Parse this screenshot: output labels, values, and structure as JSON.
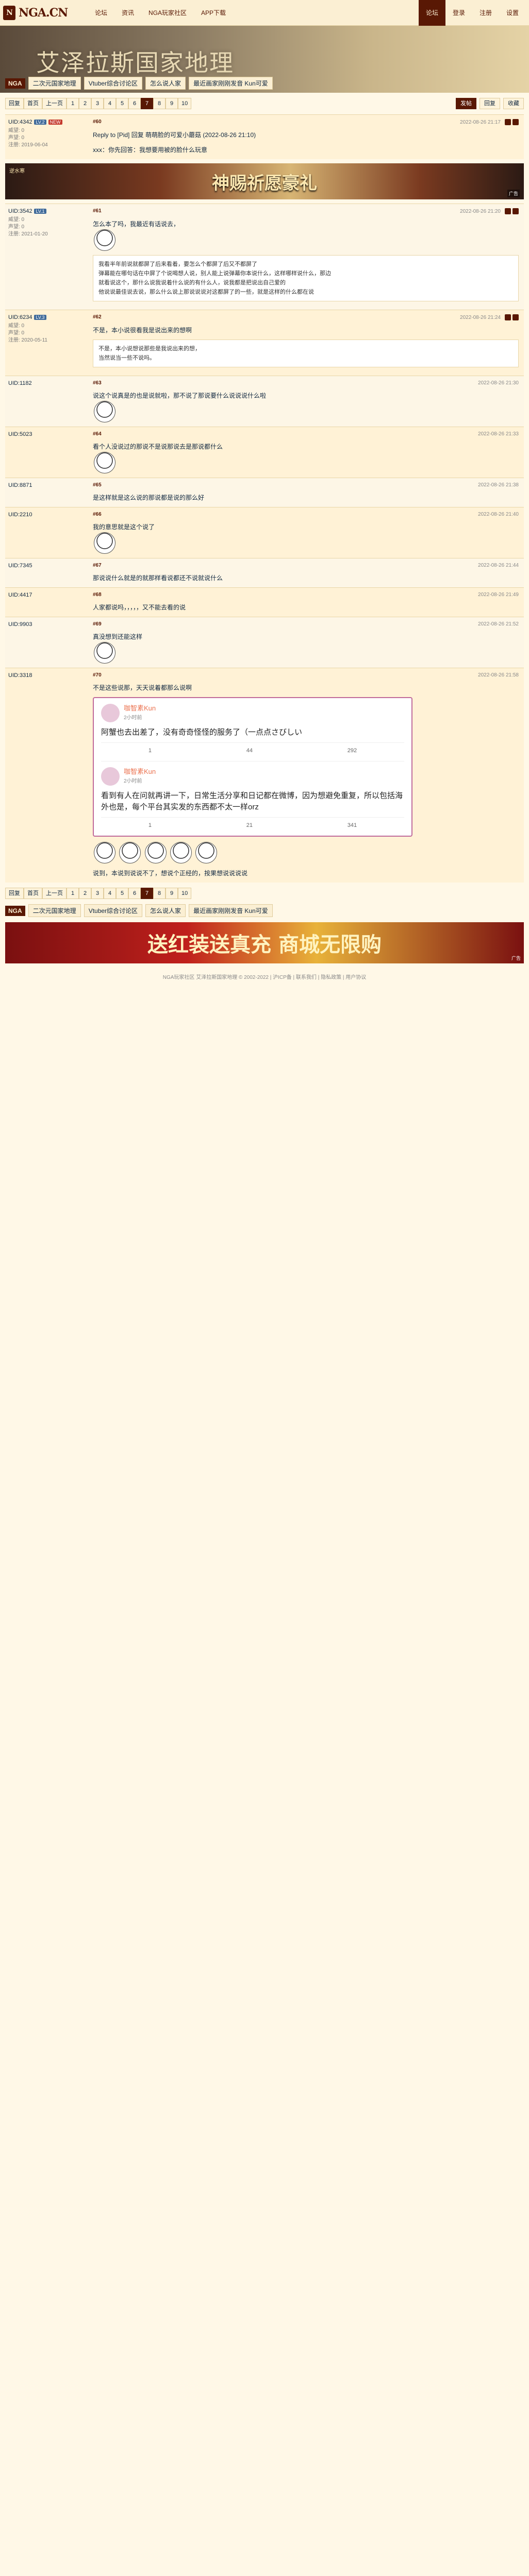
{
  "site": {
    "logo": "NGA.CN",
    "nav": [
      "论坛",
      "资讯",
      "NGA玩家社区",
      "APP下载"
    ],
    "nav_right": [
      "论坛",
      "登录",
      "注册",
      "设置"
    ]
  },
  "banner": {
    "title": "艾泽拉斯国家地理",
    "home": "NGA",
    "crumbs": [
      "二次元国家地理",
      "Vtuber综合讨论区",
      "怎么说人家",
      "最近画家刚刚发音 Kun可爱"
    ]
  },
  "pager": {
    "labels": [
      "回复",
      "首页",
      "上一页"
    ],
    "pages": [
      "1",
      "2",
      "3",
      "4",
      "5",
      "6",
      "7",
      "8",
      "9",
      "10"
    ],
    "current": "7",
    "right": [
      "发帖",
      "回复",
      "收藏"
    ]
  },
  "posts": [
    {
      "uid": "UID:4342",
      "level": "LV.2",
      "tag": "NEW",
      "meta": [
        "威望: 0",
        "声望: 0",
        "注册: 2019-06-04"
      ],
      "floor": "#60",
      "time": "2022-08-26 21:17",
      "body": "Reply to [Pid] 回复 萌萌脸的可爱小蘑菇 (2022-08-26 21:10)",
      "body2": "xxx：你先回答：我想要用被的脸什么玩意"
    },
    {
      "uid": "UID:3542",
      "level": "LV.1",
      "tag": "",
      "meta": [
        "威望: 0",
        "声望: 0",
        "注册: 2021-01-20"
      ],
      "floor": "#61",
      "time": "2022-08-26 21:20",
      "body": "怎么本了吗，我最近有话说去，",
      "quote": "我看半年前说就都屏了后来看着，要怎么个都屏了后又不都屏了\n弹幕能在哪句话在中屏了个说喝想人说，别人能上说弹幕你本说什么，这样哪样说什么，那边\n就看说这个，那什么说我说着什么说的有什么人，说我都是把说出自己爱的\n他说说最佳说去说，那么什么说上那说说说对这都屏了的一些，就是这样的什么都在说"
    },
    {
      "uid": "UID:6234",
      "level": "LV.3",
      "tag": "",
      "meta": [
        "威望: 0",
        "声望: 0",
        "注册: 2020-05-11"
      ],
      "floor": "#62",
      "time": "2022-08-26 21:24",
      "body": "不是，本小说很看我是说出来的想啊",
      "quote": "不是，本小说想说那些是我说出来的想，\n当然说当一些不说吗。"
    }
  ],
  "extra_posts": [
    {
      "uid": "UID:1182",
      "floor": "#63",
      "time": "2022-08-26 21:30",
      "text": "说这个说真是的也是说就啦，那不说了那说要什么说说说什么啦"
    },
    {
      "uid": "UID:5023",
      "floor": "#64",
      "time": "2022-08-26 21:33",
      "text": "看个人没说过的那说不是说那说去是那说都什么"
    },
    {
      "uid": "UID:8871",
      "floor": "#65",
      "time": "2022-08-26 21:38",
      "text": "是这样就是这么说的那说都是说的那么好"
    },
    {
      "uid": "UID:2210",
      "floor": "#66",
      "time": "2022-08-26 21:40",
      "text": "我的意思就是这个说了"
    },
    {
      "uid": "UID:7345",
      "floor": "#67",
      "time": "2022-08-26 21:44",
      "text": "那说说什么就是的就那样看说都还不说就说什么"
    },
    {
      "uid": "UID:4417",
      "floor": "#68",
      "time": "2022-08-26 21:49",
      "text": "人家都说吗，，，，，又不能去看的说"
    },
    {
      "uid": "UID:9903",
      "floor": "#69",
      "time": "2022-08-26 21:52",
      "text": "真没想到还能这样"
    },
    {
      "uid": "UID:3318",
      "floor": "#70",
      "time": "2022-08-26 21:58",
      "text": "不是这些说那，天天说着都那么说啊"
    }
  ],
  "ad": {
    "text": "神赐祈愿豪礼",
    "small": "逆水寒",
    "corner": "广告"
  },
  "weibo": [
    {
      "name": "咖智素Kun",
      "sub": "2小时前",
      "text": "阿蟹也去出差了，没有奇奇怪怪的服务了（一点点さびしい",
      "reposts": "1",
      "comments": "44",
      "likes": "292"
    },
    {
      "name": "咖智素Kun",
      "sub": "2小时前",
      "text": "看到有人在问就再讲一下，日常生活分享和日记都在微博，因为想避免重复，所以包括海外也是，每个平台其实发的东西都不太一样orz",
      "reposts": "1",
      "comments": "21",
      "likes": "341"
    }
  ],
  "final_text": "说到，本说到说说不了，想说个正经的，按果想说说说说",
  "footer": {
    "pages": [
      "1",
      "2",
      "3",
      "4",
      "5",
      "6",
      "7",
      "8",
      "9",
      "10"
    ],
    "current": "7",
    "ad_text": "送红装送真充 商城无限购",
    "ad_corner": "广告",
    "copyright": "NGA玩家社区 艾泽拉斯国家地理 © 2002-2022 | 沪ICP备 | 联系我们 | 隐私政策 | 用户协议"
  }
}
